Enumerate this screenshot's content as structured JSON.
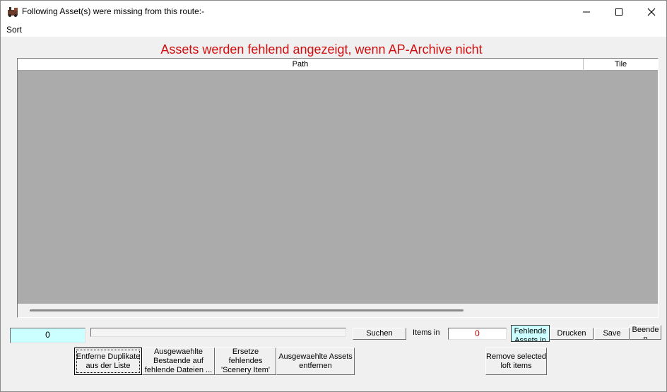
{
  "window": {
    "title": "Following Asset(s) were missing from this route:-"
  },
  "menu": {
    "sort_label": "Sort"
  },
  "heading": "Assets werden fehlend angezeigt, wenn AP-Archive nicht",
  "table": {
    "columns": [
      "Path",
      "Tile"
    ],
    "rows": []
  },
  "controls": {
    "count_value": "0",
    "search_label": "Suchen",
    "items_in_label": "Items in ...",
    "items_value": "0",
    "fehlende_label": "Fehlende Assets in",
    "drucken_label": "Drucken",
    "save_label": "Save",
    "beenden_label": "Beende n",
    "remove_duplicates_label": "Entferne Duplikate aus der Liste",
    "mark_existing_label": "Ausgewaehlte Bestaende auf fehlende Dateien ...",
    "replace_scenery_label": "Ersetze fehlendes 'Scenery Item'",
    "remove_selected_label": "Ausgewaehlte Assets entfernen",
    "remove_loft_label": "Remove selected loft items"
  },
  "colors": {
    "heading": "#d01010",
    "list_background": "#ababab",
    "count_field": "#ccffff",
    "items_value": "#c00000"
  },
  "icons": {
    "app": "train-icon",
    "minimize": "minimize-icon",
    "maximize": "maximize-icon",
    "close": "close-icon"
  }
}
